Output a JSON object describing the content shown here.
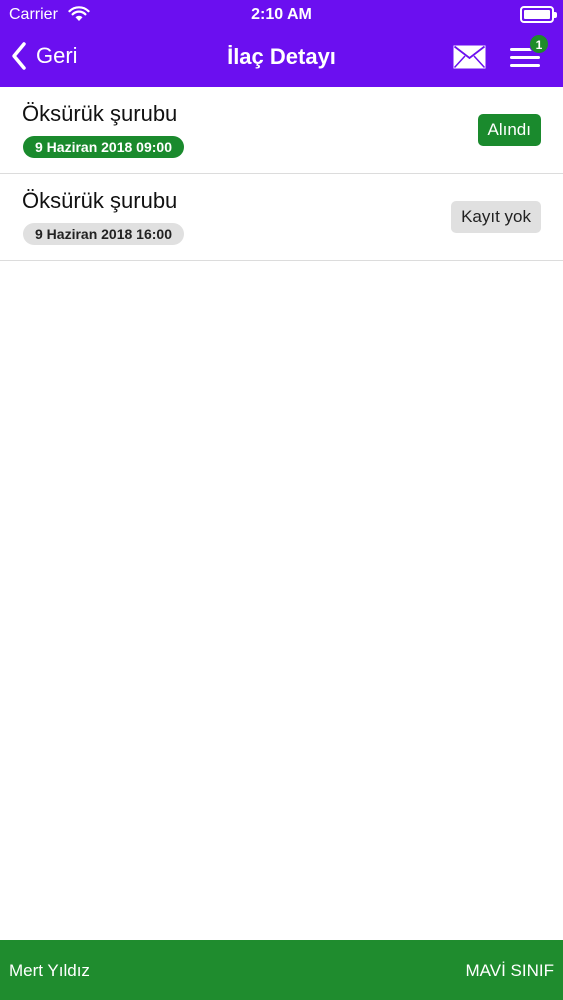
{
  "status_bar": {
    "carrier": "Carrier",
    "time": "2:10 AM",
    "wifi_icon": "wifi-icon",
    "battery_icon": "battery-icon"
  },
  "nav": {
    "back_label": "Geri",
    "title": "İlaç Detayı",
    "mail_icon": "mail-icon",
    "menu_icon": "menu-icon",
    "badge_count": "1"
  },
  "items": [
    {
      "name": "Öksürük şurubu",
      "datetime": "9 Haziran 2018 09:00",
      "status": "Alındı",
      "status_color": "#1a8a2d"
    },
    {
      "name": "Öksürük şurubu",
      "datetime": "9 Haziran 2018 16:00",
      "status": "Kayıt yok",
      "status_color": "#e0e0e0"
    }
  ],
  "footer": {
    "user_name": "Mert Yıldız",
    "class_name": "MAVİ SINIF"
  },
  "colors": {
    "header": "#6b0ff0",
    "footer": "#1f8c2e",
    "green": "#1a8a2d",
    "gray": "#e0e0e0"
  }
}
